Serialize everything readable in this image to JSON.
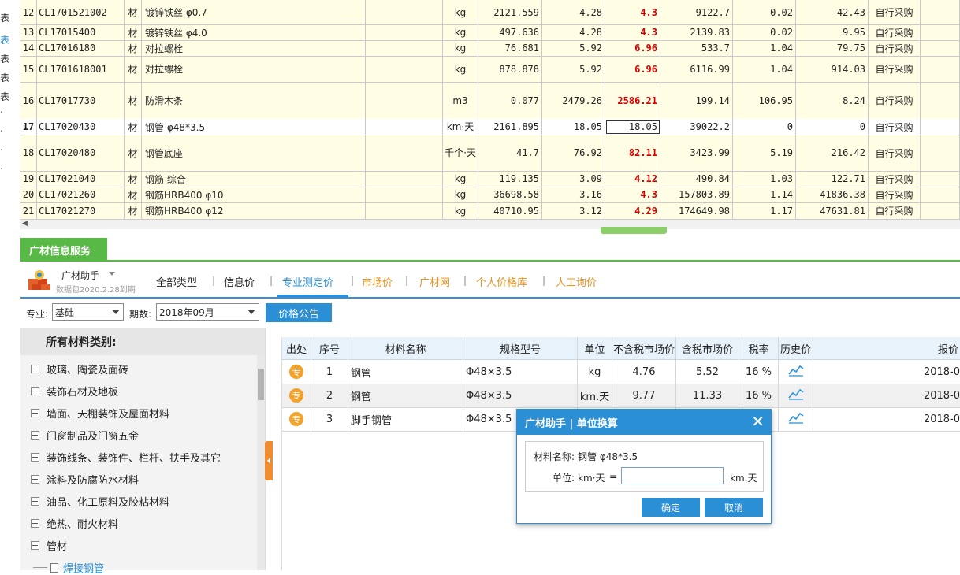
{
  "left_strip": [
    "表",
    "表",
    "表",
    "表",
    "表",
    ".",
    ".",
    ".",
    "."
  ],
  "grid_rows": [
    {
      "no": "12",
      "code": "CL1701521002",
      "type": "材",
      "name": "镀锌铁丝 φ0.7",
      "unit": "kg",
      "qty": "2121.559",
      "price": "4.28",
      "market": "4.3",
      "total": "9122.7",
      "tax": "0.02",
      "diff": "42.43",
      "src": "自行采购"
    },
    {
      "no": "13",
      "code": "CL17015400",
      "type": "材",
      "name": "镀锌铁丝 φ4.0",
      "unit": "kg",
      "qty": "497.636",
      "price": "4.28",
      "market": "4.3",
      "total": "2139.83",
      "tax": "0.02",
      "diff": "9.95",
      "src": "自行采购"
    },
    {
      "no": "14",
      "code": "CL17016180",
      "type": "材",
      "name": "对拉螺栓",
      "unit": "kg",
      "qty": "76.681",
      "price": "5.92",
      "market": "6.96",
      "total": "533.7",
      "tax": "1.04",
      "diff": "79.75",
      "src": "自行采购"
    },
    {
      "no": "15",
      "code": "CL1701618001",
      "type": "材",
      "name": "对拉螺栓",
      "unit": "kg",
      "qty": "878.878",
      "price": "5.92",
      "market": "6.96",
      "total": "6116.99",
      "tax": "1.04",
      "diff": "914.03",
      "src": "自行采购"
    },
    {
      "no": "16",
      "code": "CL17017730",
      "type": "材",
      "name": "防滑木条",
      "unit": "m3",
      "qty": "0.077",
      "price": "2479.26",
      "market": "2586.21",
      "total": "199.14",
      "tax": "106.95",
      "diff": "8.24",
      "src": "自行采购"
    },
    {
      "no": "17",
      "code": "CL17020430",
      "type": "材",
      "name": "钢管 φ48*3.5",
      "unit": "km·天",
      "qty": "2161.895",
      "price": "18.05",
      "market": "18.05",
      "total": "39022.2",
      "tax": "0",
      "diff": "0",
      "src": "自行采购"
    },
    {
      "no": "18",
      "code": "CL17020480",
      "type": "材",
      "name": "钢管底座",
      "unit": "千个·天",
      "qty": "41.7",
      "price": "76.92",
      "market": "82.11",
      "total": "3423.99",
      "tax": "5.19",
      "diff": "216.42",
      "src": "自行采购"
    },
    {
      "no": "19",
      "code": "CL17021040",
      "type": "材",
      "name": "钢筋 综合",
      "unit": "kg",
      "qty": "119.135",
      "price": "3.09",
      "market": "4.12",
      "total": "490.84",
      "tax": "1.03",
      "diff": "122.71",
      "src": "自行采购"
    },
    {
      "no": "20",
      "code": "CL17021260",
      "type": "材",
      "name": "钢筋HRB400 φ10",
      "unit": "kg",
      "qty": "36698.58",
      "price": "3.16",
      "market": "4.3",
      "total": "157803.89",
      "tax": "1.14",
      "diff": "41836.38",
      "src": "自行采购"
    },
    {
      "no": "21",
      "code": "CL17021270",
      "type": "材",
      "name": "钢筋HRB400 φ12",
      "unit": "kg",
      "qty": "40710.95",
      "price": "3.12",
      "market": "4.29",
      "total": "174649.98",
      "tax": "1.17",
      "diff": "47631.81",
      "src": "自行采购"
    }
  ],
  "panel_tab": "广材信息服务",
  "assistant": {
    "name": "广材助手",
    "sub": "数据包2020.2.28到期"
  },
  "nav": [
    "全部类型",
    "信息价",
    "专业测定价",
    "市场价",
    "广材网",
    "个人价格库",
    "人工询价"
  ],
  "filter": {
    "major_label": "专业:",
    "major_value": "基础",
    "period_label": "期数:",
    "period_value": "2018年09月",
    "notice_btn": "价格公告"
  },
  "tree": {
    "title": "所有材料类别:",
    "items": [
      "玻璃、陶瓷及面砖",
      "装饰石材及地板",
      "墙面、天棚装饰及屋面材料",
      "门窗制品及门窗五金",
      "装饰线条、装饰件、栏杆、扶手及其它",
      "涂料及防腐防水材料",
      "油品、化工原料及胶粘材料",
      "绝热、耐火材料",
      "管材"
    ],
    "child": "焊接钢管"
  },
  "table": {
    "headers": [
      "出处",
      "序号",
      "材料名称",
      "规格型号",
      "单位",
      "不含税市场价",
      "含税市场价",
      "税率",
      "历史价",
      "报价"
    ],
    "rows": [
      {
        "src": "专",
        "no": "1",
        "name": "钢管",
        "spec": "Φ48×3.5",
        "unit": "kg",
        "price": "4.76",
        "tax_price": "5.52",
        "rate": "16 %",
        "date": "2018-0"
      },
      {
        "src": "专",
        "no": "2",
        "name": "钢管",
        "spec": "Φ48×3.5",
        "unit": "km.天",
        "price": "9.77",
        "tax_price": "11.33",
        "rate": "16 %",
        "date": "2018-0"
      },
      {
        "src": "专",
        "no": "3",
        "name": "脚手钢管",
        "spec": "Φ48×3.5",
        "unit": "",
        "price": "",
        "tax_price": "",
        "rate": "",
        "date": "2018-0"
      }
    ]
  },
  "dialog": {
    "title": "广材助手 | 单位换算",
    "material_label": "材料名称:",
    "material_value": "钢管 φ48*3.5",
    "unit_label": "单位:",
    "unit_from": "km·天",
    "eq": "=",
    "input_value": "",
    "unit_to": "km.天",
    "ok": "确定",
    "cancel": "取消"
  },
  "colors": {
    "grid_bg": "#fffde3",
    "accent": "#2b8fd6",
    "green": "#58b947",
    "orange": "#f3a32b",
    "red": "#d40000"
  }
}
